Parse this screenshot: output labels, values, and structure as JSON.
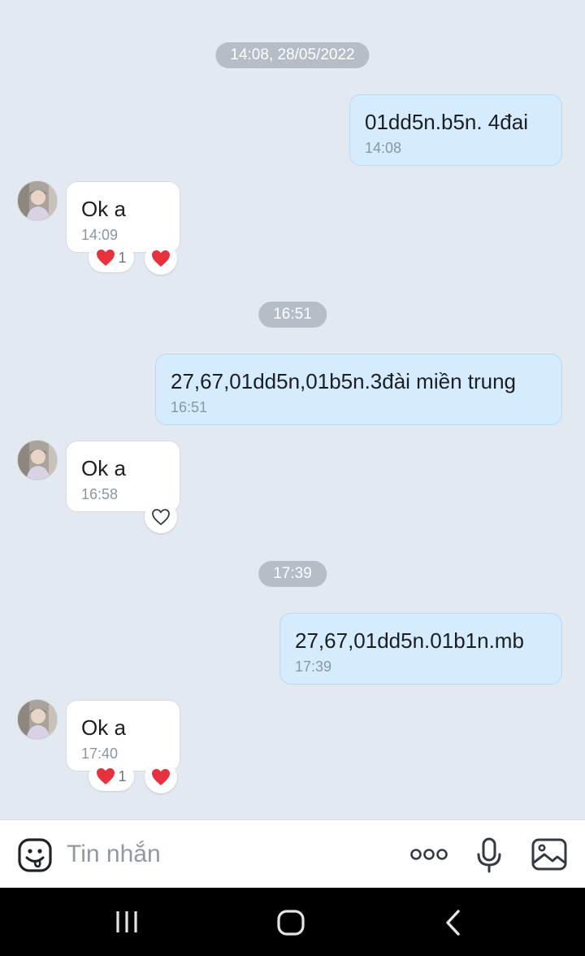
{
  "messages": {
    "date_1": "14:08, 28/05/2022",
    "out_1": {
      "text": "01dd5n.b5n. 4đai",
      "time": "14:08"
    },
    "in_1": {
      "text": "Ok a",
      "time": "14:09",
      "reaction_count": "1"
    },
    "date_2": "16:51",
    "out_2": {
      "text": "27,67,01dd5n,01b5n.3đài miền trung",
      "time": "16:51"
    },
    "in_2": {
      "text": "Ok a",
      "time": "16:58"
    },
    "date_3": "17:39",
    "out_3": {
      "text": "27,67,01dd5n.01b1n.mb",
      "time": "17:39"
    },
    "in_3": {
      "text": "Ok a",
      "time": "17:40",
      "reaction_count": "1"
    }
  },
  "input_bar": {
    "placeholder": "Tin nhắn",
    "icons": [
      "sticker-icon",
      "more-icon",
      "microphone-icon",
      "image-icon"
    ]
  },
  "nav_bar": {
    "icons": [
      "recent-apps-icon",
      "home-icon",
      "back-icon"
    ]
  },
  "colors": {
    "background": "#e2e9f1",
    "outgoing_bubble": "#d4ecfd",
    "incoming_bubble": "#ffffff",
    "date_chip": "#b6bdc6",
    "heart": "#e8313f"
  }
}
